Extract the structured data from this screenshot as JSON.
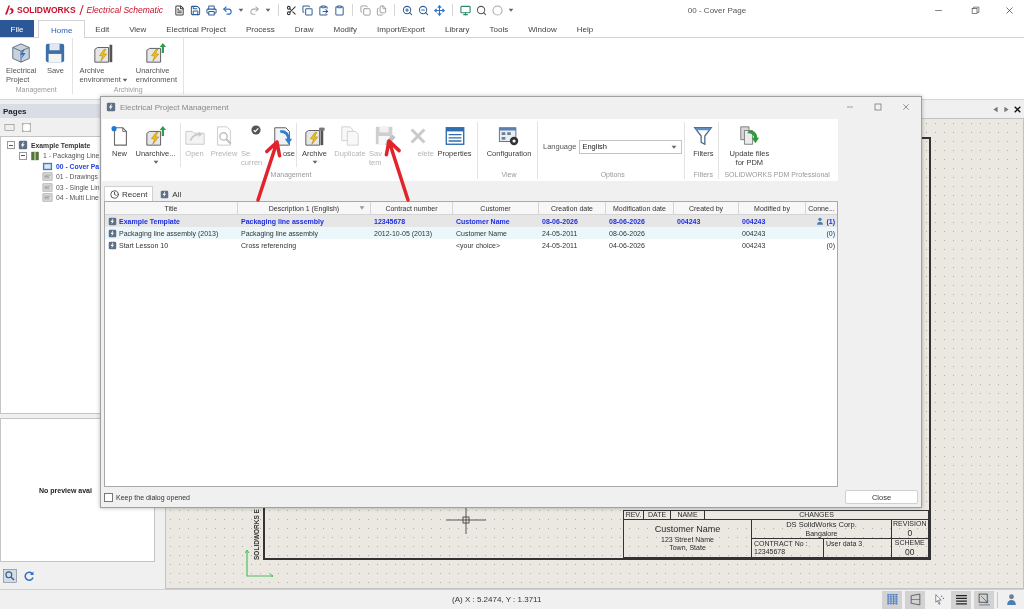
{
  "app_bar": {
    "brand": "SOLIDWORKS",
    "product": "Electrical Schematic",
    "document_title": "00 - Cover Page"
  },
  "menu_tabs": [
    {
      "label": "File",
      "kind": "backstage",
      "selected": false
    },
    {
      "label": "Home",
      "kind": "tab",
      "selected": true
    },
    {
      "label": "Edit",
      "kind": "tab",
      "selected": false
    },
    {
      "label": "View",
      "kind": "tab",
      "selected": false
    },
    {
      "label": "Electrical Project",
      "kind": "tab",
      "selected": false
    },
    {
      "label": "Process",
      "kind": "tab",
      "selected": false
    },
    {
      "label": "Draw",
      "kind": "tab",
      "selected": false
    },
    {
      "label": "Modify",
      "kind": "tab",
      "selected": false
    },
    {
      "label": "Import/Export",
      "kind": "tab",
      "selected": false
    },
    {
      "label": "Library",
      "kind": "tab",
      "selected": false
    },
    {
      "label": "Tools",
      "kind": "tab",
      "selected": false
    },
    {
      "label": "Window",
      "kind": "tab",
      "selected": false
    },
    {
      "label": "Help",
      "kind": "tab",
      "selected": false
    }
  ],
  "ribbon": {
    "groups": [
      {
        "label": "Management",
        "buttons": [
          {
            "lines": [
              "Electrical",
              "Project"
            ],
            "dropdown": false
          },
          {
            "lines": [
              "Save"
            ],
            "dropdown": false
          }
        ]
      },
      {
        "label": "Archiving",
        "buttons": [
          {
            "lines": [
              "Archive",
              "environment"
            ],
            "dropdown": true
          },
          {
            "lines": [
              "Unarchive",
              "environment"
            ],
            "dropdown": false
          }
        ]
      }
    ]
  },
  "pages_panel": {
    "title": "Pages",
    "tree": [
      {
        "label": "Example Template",
        "expanded": true,
        "selected": false,
        "children": [
          {
            "label": "1 - Packaging Line",
            "expanded": true,
            "selected": false,
            "children": [
              {
                "label": "00 - Cover Pa",
                "selected": true
              },
              {
                "label": "01 - Drawings",
                "selected": false
              },
              {
                "label": "03 - Single Lin",
                "selected": false
              },
              {
                "label": "04 - Multi Line",
                "selected": false
              }
            ]
          }
        ]
      }
    ],
    "preview_text": "No preview avai"
  },
  "drawing": {
    "frame_text": "SOLIDWORKS E",
    "title_block": {
      "columns": [
        "REV.",
        "DATE",
        "NAME",
        "CHANGES"
      ],
      "customer_name": "Customer Name",
      "customer_address": [
        "123 Street Name",
        "Town, State"
      ],
      "company": "DS SolidWorks Corp.",
      "city": "Bangalore",
      "contract_label": "CONTRACT No :",
      "contract": "12345678",
      "user_data_label": "User data 3",
      "revision_label": "REVISION",
      "revision": "0",
      "scheme_label": "SCHEME",
      "scheme": "00"
    }
  },
  "status_bar": {
    "coordinates": "(A) X : 5.2474, Y : 1.3711",
    "toggles": [
      {
        "on": true
      },
      {
        "on": true
      },
      {
        "on": false
      },
      {
        "on": true
      },
      {
        "on": true
      },
      {
        "on": false
      }
    ]
  },
  "dialog": {
    "title": "Electrical Project Management",
    "toolbar": {
      "groups": [
        {
          "label": "Management",
          "kind": "buttons",
          "sections": [
            [
              {
                "lines": [
                  "New"
                ],
                "disabled": false,
                "dropdown": false
              },
              {
                "lines": [
                  "Unarchive..."
                ],
                "disabled": false,
                "dropdown": true
              }
            ],
            [
              {
                "lines": [
                  "Open"
                ],
                "disabled": true,
                "dropdown": false
              },
              {
                "lines": [
                  "Preview"
                ],
                "disabled": true,
                "dropdown": false
              },
              {
                "lines": [
                  "Se",
                  "curren"
                ],
                "disabled": true,
                "dropdown": false
              },
              {
                "lines": [
                  "ose"
                ],
                "disabled": false,
                "dropdown": false
              }
            ],
            [
              {
                "lines": [
                  "Archive"
                ],
                "disabled": false,
                "dropdown": true
              },
              {
                "lines": [
                  "Duplicate"
                ],
                "disabled": true,
                "dropdown": false
              },
              {
                "lines": [
                  "Sav",
                  "tem"
                ],
                "disabled": true,
                "dropdown": false
              },
              {
                "lines": [
                  "elete"
                ],
                "disabled": true,
                "dropdown": false
              },
              {
                "lines": [
                  "Properties"
                ],
                "disabled": false,
                "dropdown": false
              }
            ]
          ]
        },
        {
          "label": "View",
          "kind": "buttons",
          "sections": [
            [
              {
                "lines": [
                  "Configuration"
                ],
                "disabled": false,
                "dropdown": false
              }
            ]
          ]
        },
        {
          "label": "Options",
          "kind": "language",
          "language": {
            "label": "Language",
            "value": "English"
          }
        },
        {
          "label": "Filters",
          "kind": "buttons",
          "sections": [
            [
              {
                "lines": [
                  "Filters"
                ],
                "disabled": false,
                "dropdown": false
              }
            ]
          ]
        },
        {
          "label": "SOLIDWORKS PDM Professional",
          "kind": "buttons",
          "sections": [
            [
              {
                "lines": [
                  "Update files",
                  "for PDM"
                ],
                "disabled": false,
                "dropdown": false
              }
            ]
          ]
        }
      ]
    },
    "view_tabs": [
      {
        "label": "Recent",
        "selected": true
      },
      {
        "label": "All",
        "selected": false
      }
    ],
    "table": {
      "columns": [
        {
          "label": "Title",
          "sorted": false
        },
        {
          "label": "Description 1 (English)",
          "sorted": true
        },
        {
          "label": "Contract number",
          "sorted": false
        },
        {
          "label": "Customer",
          "sorted": false
        },
        {
          "label": "Creation date",
          "sorted": false
        },
        {
          "label": "Modification date",
          "sorted": false
        },
        {
          "label": "Created by",
          "sorted": false
        },
        {
          "label": "Modified by",
          "sorted": false
        },
        {
          "label": "Conne...",
          "sorted": false
        }
      ],
      "rows": [
        {
          "current": true,
          "selected": true,
          "in_use": true,
          "title": "Example Template",
          "description_1": "Packaging line assembly",
          "contract_number": "12345678",
          "customer": "Customer Name",
          "creation_date": "08-06-2026",
          "modification_date": "08-06-2026",
          "created_by": "004243",
          "modified_by": "004243",
          "connections": "(1)"
        },
        {
          "current": false,
          "selected": false,
          "in_use": false,
          "title": "Packaging line assembly (2013)",
          "description_1": "Packaging line assembly",
          "contract_number": "2012-10-05 (2013)",
          "customer": "Customer Name",
          "creation_date": "24-05-2011",
          "modification_date": "08-06-2026",
          "modified_by": "004243",
          "connections": "(0)"
        },
        {
          "current": false,
          "selected": false,
          "in_use": false,
          "title": "Start Lesson 10",
          "description_1": "Cross referencing",
          "customer": "<your choice>",
          "creation_date": "24-05-2011",
          "modification_date": "04-06-2026",
          "modified_by": "004243",
          "connections": "(0)"
        }
      ]
    },
    "keep_open": {
      "label": "Keep the dialog opened",
      "checked": false
    },
    "close_button": "Close"
  }
}
